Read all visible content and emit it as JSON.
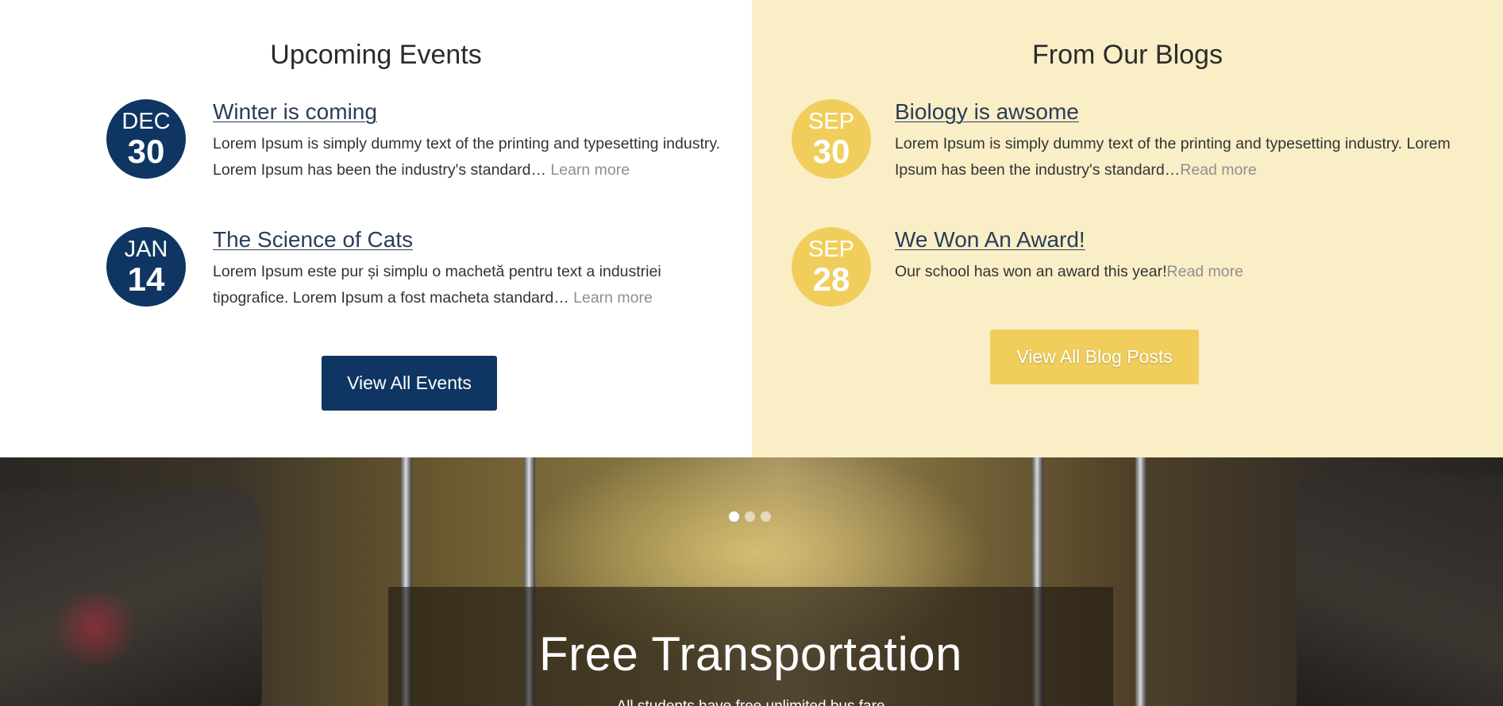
{
  "events": {
    "heading": "Upcoming Events",
    "items": [
      {
        "month": "DEC",
        "day": "30",
        "title": "Winter is coming",
        "text": "Lorem Ipsum is simply dummy text of the printing and typesetting industry. Lorem Ipsum has been the industry's standard… ",
        "more": "Learn more"
      },
      {
        "month": "JAN",
        "day": "14",
        "title": "The Science of Cats",
        "text": "Lorem Ipsum este pur și simplu o machetă pentru text a industriei tipografice. Lorem Ipsum a fost macheta standard… ",
        "more": "Learn more"
      }
    ],
    "button_label": "View All Events",
    "colors": {
      "accent": "#0f3562"
    }
  },
  "blogs": {
    "heading": "From Our Blogs",
    "items": [
      {
        "month": "SEP",
        "day": "30",
        "title": "Biology is awsome",
        "text": "Lorem Ipsum is simply dummy text of the printing and typesetting industry. Lorem Ipsum has been the industry's standard…",
        "more": "Read more"
      },
      {
        "month": "SEP",
        "day": "28",
        "title": "We Won An Award!",
        "text": "Our school has won an award this year!",
        "more": "Read more"
      }
    ],
    "button_label": "View All Blog Posts",
    "colors": {
      "accent": "#f1ce5c",
      "background": "#f9eec6"
    }
  },
  "hero": {
    "slide_count": 3,
    "active_slide": 1,
    "title": "Free Transportation",
    "subtitle": "All students have free unlimited bus fare"
  }
}
